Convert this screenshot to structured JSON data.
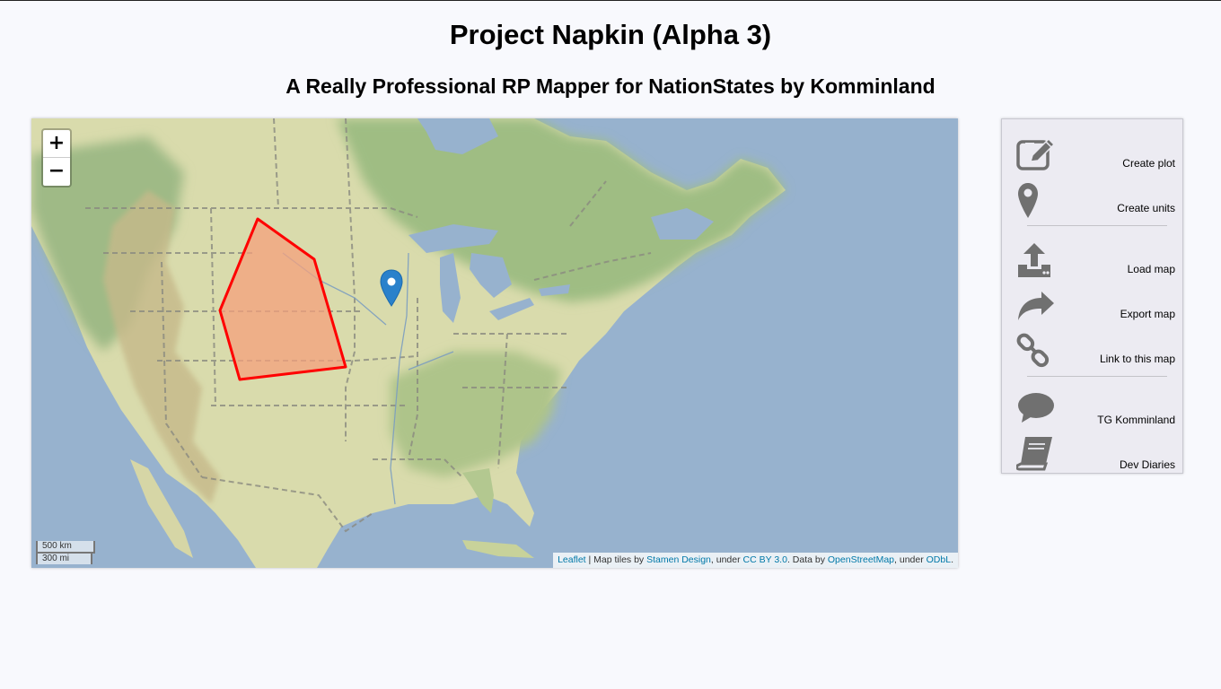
{
  "header": {
    "title": "Project Napkin (Alpha 3)",
    "subtitle": "A Really Professional RP Mapper for NationStates by Komminland"
  },
  "map": {
    "zoom_in_label": "+",
    "zoom_out_label": "−",
    "scale_km": "500 km",
    "scale_mi": "300 mi",
    "attribution": {
      "leaflet": "Leaflet",
      "sep1": " | Map tiles by ",
      "stamen": "Stamen Design",
      "sep2": ", under ",
      "ccby": "CC BY 3.0",
      "sep3": ". Data by ",
      "osm": "OpenStreetMap",
      "sep4": ", under ",
      "odbl": "ODbL",
      "end": "."
    },
    "plot_color": "#ff0000",
    "plot_fill": "#f4a07c",
    "marker_color": "#2a81cb"
  },
  "menu": {
    "items": [
      {
        "label": "Create plot",
        "icon": "edit-icon"
      },
      {
        "label": "Create units",
        "icon": "map-marker-icon"
      },
      {
        "label": "Load map",
        "icon": "upload-icon"
      },
      {
        "label": "Export map",
        "icon": "share-icon"
      },
      {
        "label": "Link to this map",
        "icon": "link-icon"
      },
      {
        "label": "TG Komminland",
        "icon": "comment-icon"
      },
      {
        "label": "Dev Diaries",
        "icon": "book-icon"
      }
    ]
  }
}
